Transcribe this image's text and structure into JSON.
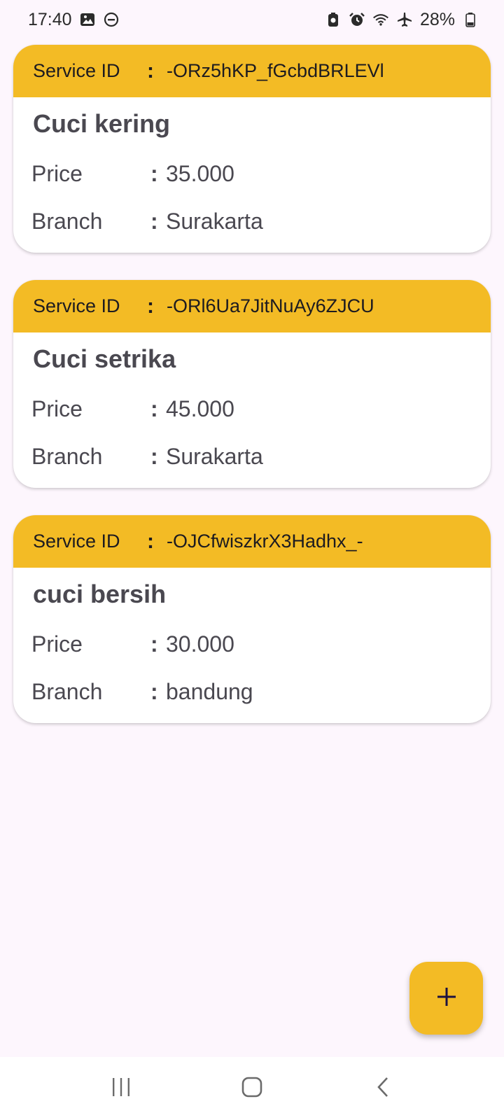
{
  "status_bar": {
    "time": "17:40",
    "battery": "28%",
    "icons_left": [
      "gallery-icon",
      "dnd-icon"
    ],
    "icons_right": [
      "battery-saver-icon",
      "alarm-icon",
      "wifi-icon",
      "airplane-icon",
      "battery-icon"
    ]
  },
  "services": [
    {
      "id_label": "Service ID",
      "id_value": "-ORz5hKP_fGcbdBRLEVl",
      "name": "Cuci kering",
      "price_label": "Price",
      "price": "35.000",
      "branch_label": "Branch",
      "branch": "Surakarta"
    },
    {
      "id_label": "Service ID",
      "id_value": "-ORl6Ua7JitNuAy6ZJCU",
      "name": "Cuci setrika",
      "price_label": "Price",
      "price": "45.000",
      "branch_label": "Branch",
      "branch": "Surakarta"
    },
    {
      "id_label": "Service ID",
      "id_value": "-OJCfwiszkrX3Hadhx_-",
      "name": "cuci bersih",
      "price_label": "Price",
      "price": "30.000",
      "branch_label": "Branch",
      "branch": "bandung"
    }
  ],
  "separator": ":",
  "colors": {
    "accent": "#f3bb25",
    "background": "#fdf6fd",
    "card": "#ffffff",
    "text": "#4a4850"
  },
  "fab": {
    "icon": "plus-icon"
  },
  "nav_bar": {
    "buttons": [
      "recent-apps-icon",
      "home-icon",
      "back-icon"
    ]
  }
}
